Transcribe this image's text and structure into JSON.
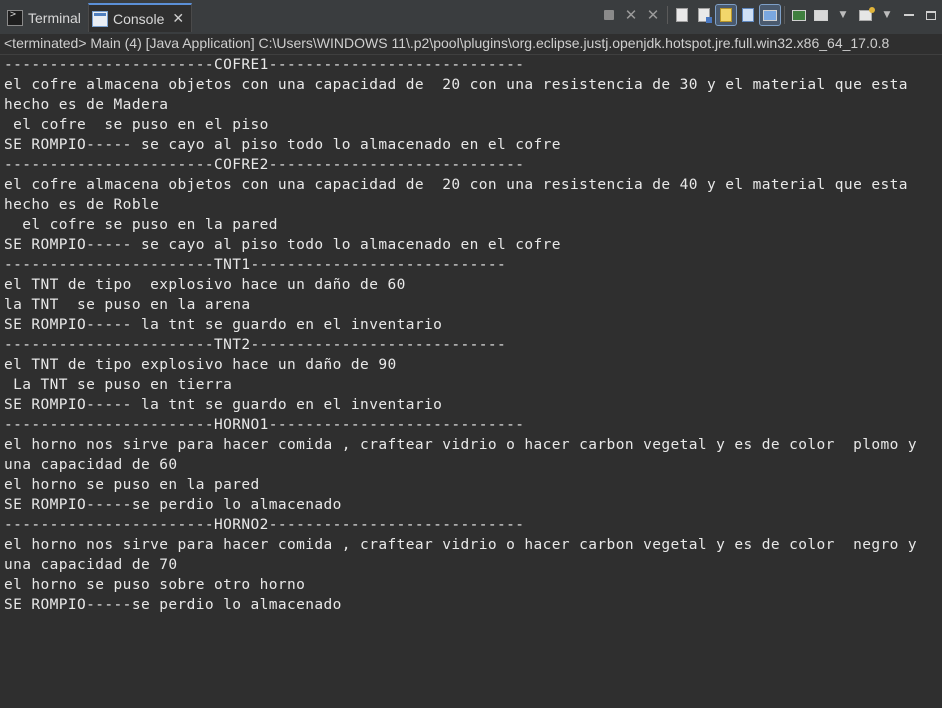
{
  "tabs": {
    "terminal": "Terminal",
    "console": "Console",
    "console_close": "✕"
  },
  "status_line": "<terminated> Main (4) [Java Application] C:\\Users\\WINDOWS 11\\.p2\\pool\\plugins\\org.eclipse.justj.openjdk.hotspot.jre.full.win32.x86_64_17.0.8",
  "toolbar_icons": [
    "terminate-icon",
    "remove-launch-icon",
    "remove-all-terminated-icon",
    "clear-console-icon",
    "scroll-lock-icon",
    "word-wrap-icon",
    "show-when-stdout-icon",
    "show-when-stderr-icon",
    "pin-console-icon",
    "display-selected-console-icon",
    "open-console-icon",
    "view-menu-icon",
    "minimize-icon",
    "maximize-icon"
  ],
  "console_lines": [
    "-----------------------COFRE1----------------------------",
    "el cofre almacena objetos con una capacidad de  20 con una resistencia de 30 y el material que esta",
    "hecho es de Madera",
    " el cofre  se puso en el piso",
    "SE ROMPIO----- se cayo al piso todo lo almacenado en el cofre",
    "-----------------------COFRE2----------------------------",
    "el cofre almacena objetos con una capacidad de  20 con una resistencia de 40 y el material que esta",
    "hecho es de Roble",
    "  el cofre se puso en la pared",
    "SE ROMPIO----- se cayo al piso todo lo almacenado en el cofre",
    "-----------------------TNT1----------------------------",
    "el TNT de tipo  explosivo hace un daño de 60",
    "la TNT  se puso en la arena",
    "SE ROMPIO----- la tnt se guardo en el inventario",
    "-----------------------TNT2----------------------------",
    "el TNT de tipo explosivo hace un daño de 90",
    " La TNT se puso en tierra",
    "SE ROMPIO----- la tnt se guardo en el inventario",
    "-----------------------HORNO1----------------------------",
    "el horno nos sirve para hacer comida , craftear vidrio o hacer carbon vegetal y es de color  plomo y",
    "una capacidad de 60",
    "el horno se puso en la pared",
    "SE ROMPIO-----se perdio lo almacenado",
    "-----------------------HORNO2----------------------------",
    "el horno nos sirve para hacer comida , craftear vidrio o hacer carbon vegetal y es de color  negro y",
    "una capacidad de 70",
    "el horno se puso sobre otro horno",
    "SE ROMPIO-----se perdio lo almacenado"
  ],
  "colors": {
    "background": "#2f2f2f",
    "text": "#e8e8e8",
    "tabbar": "#3a3d3f",
    "active_tab_accent": "#5b8fd6"
  }
}
